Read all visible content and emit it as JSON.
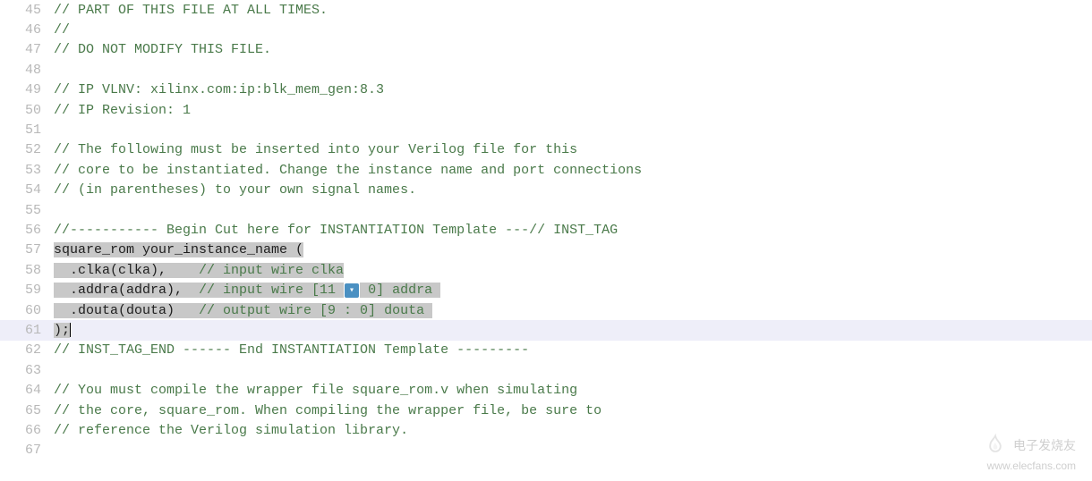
{
  "lines": [
    {
      "num": 45,
      "segments": [
        {
          "cls": "comment",
          "text": "// PART OF THIS FILE AT ALL TIMES."
        }
      ]
    },
    {
      "num": 46,
      "segments": [
        {
          "cls": "comment",
          "text": "//"
        }
      ]
    },
    {
      "num": 47,
      "segments": [
        {
          "cls": "comment",
          "text": "// DO NOT MODIFY THIS FILE."
        }
      ]
    },
    {
      "num": 48,
      "segments": []
    },
    {
      "num": 49,
      "segments": [
        {
          "cls": "comment",
          "text": "// IP VLNV: xilinx.com:ip:blk_mem_gen:8.3"
        }
      ]
    },
    {
      "num": 50,
      "segments": [
        {
          "cls": "comment",
          "text": "// IP Revision: 1"
        }
      ]
    },
    {
      "num": 51,
      "segments": []
    },
    {
      "num": 52,
      "segments": [
        {
          "cls": "comment",
          "text": "// The following must be inserted into your Verilog file for this"
        }
      ]
    },
    {
      "num": 53,
      "segments": [
        {
          "cls": "comment",
          "text": "// core to be instantiated. Change the instance name and port connections"
        }
      ]
    },
    {
      "num": 54,
      "segments": [
        {
          "cls": "comment",
          "text": "// (in parentheses) to your own signal names."
        }
      ]
    },
    {
      "num": 55,
      "segments": []
    },
    {
      "num": 56,
      "segments": [
        {
          "cls": "comment",
          "text": "//----------- Begin Cut here for INSTANTIATION Template ---// INST_TAG"
        }
      ]
    },
    {
      "num": 57,
      "segments": [
        {
          "cls": "normal sel",
          "text": "square_rom your_instance_name ("
        }
      ]
    },
    {
      "num": 58,
      "segments": [
        {
          "cls": "normal sel",
          "text": "  .clka(clka),    "
        },
        {
          "cls": "comment sel",
          "text": "// input wire clka"
        }
      ]
    },
    {
      "num": 59,
      "segments": [
        {
          "cls": "normal sel",
          "text": "  .addra(addra),  "
        },
        {
          "cls": "comment sel",
          "text": "// input wire [11 "
        },
        {
          "badge": true
        },
        {
          "cls": "comment sel",
          "text": " 0] addra "
        }
      ]
    },
    {
      "num": 60,
      "segments": [
        {
          "cls": "normal sel",
          "text": "  .douta(douta)   "
        },
        {
          "cls": "comment sel",
          "text": "// output wire [9 : 0] douta "
        }
      ]
    },
    {
      "num": 61,
      "current": true,
      "segments": [
        {
          "cls": "normal sel",
          "text": ");"
        },
        {
          "caret": true
        }
      ]
    },
    {
      "num": 62,
      "segments": [
        {
          "cls": "comment",
          "text": "// INST_TAG_END ------ End INSTANTIATION Template ---------"
        }
      ]
    },
    {
      "num": 63,
      "segments": []
    },
    {
      "num": 64,
      "segments": [
        {
          "cls": "comment",
          "text": "// You must compile the wrapper file square_rom.v when simulating"
        }
      ]
    },
    {
      "num": 65,
      "segments": [
        {
          "cls": "comment",
          "text": "// the core, square_rom. When compiling the wrapper file, be sure to"
        }
      ]
    },
    {
      "num": 66,
      "segments": [
        {
          "cls": "comment",
          "text": "// reference the Verilog simulation library."
        }
      ]
    },
    {
      "num": 67,
      "segments": []
    }
  ],
  "badge_char": "▾",
  "watermark": {
    "brand": "电子发烧友",
    "url": "www.elecfans.com"
  }
}
